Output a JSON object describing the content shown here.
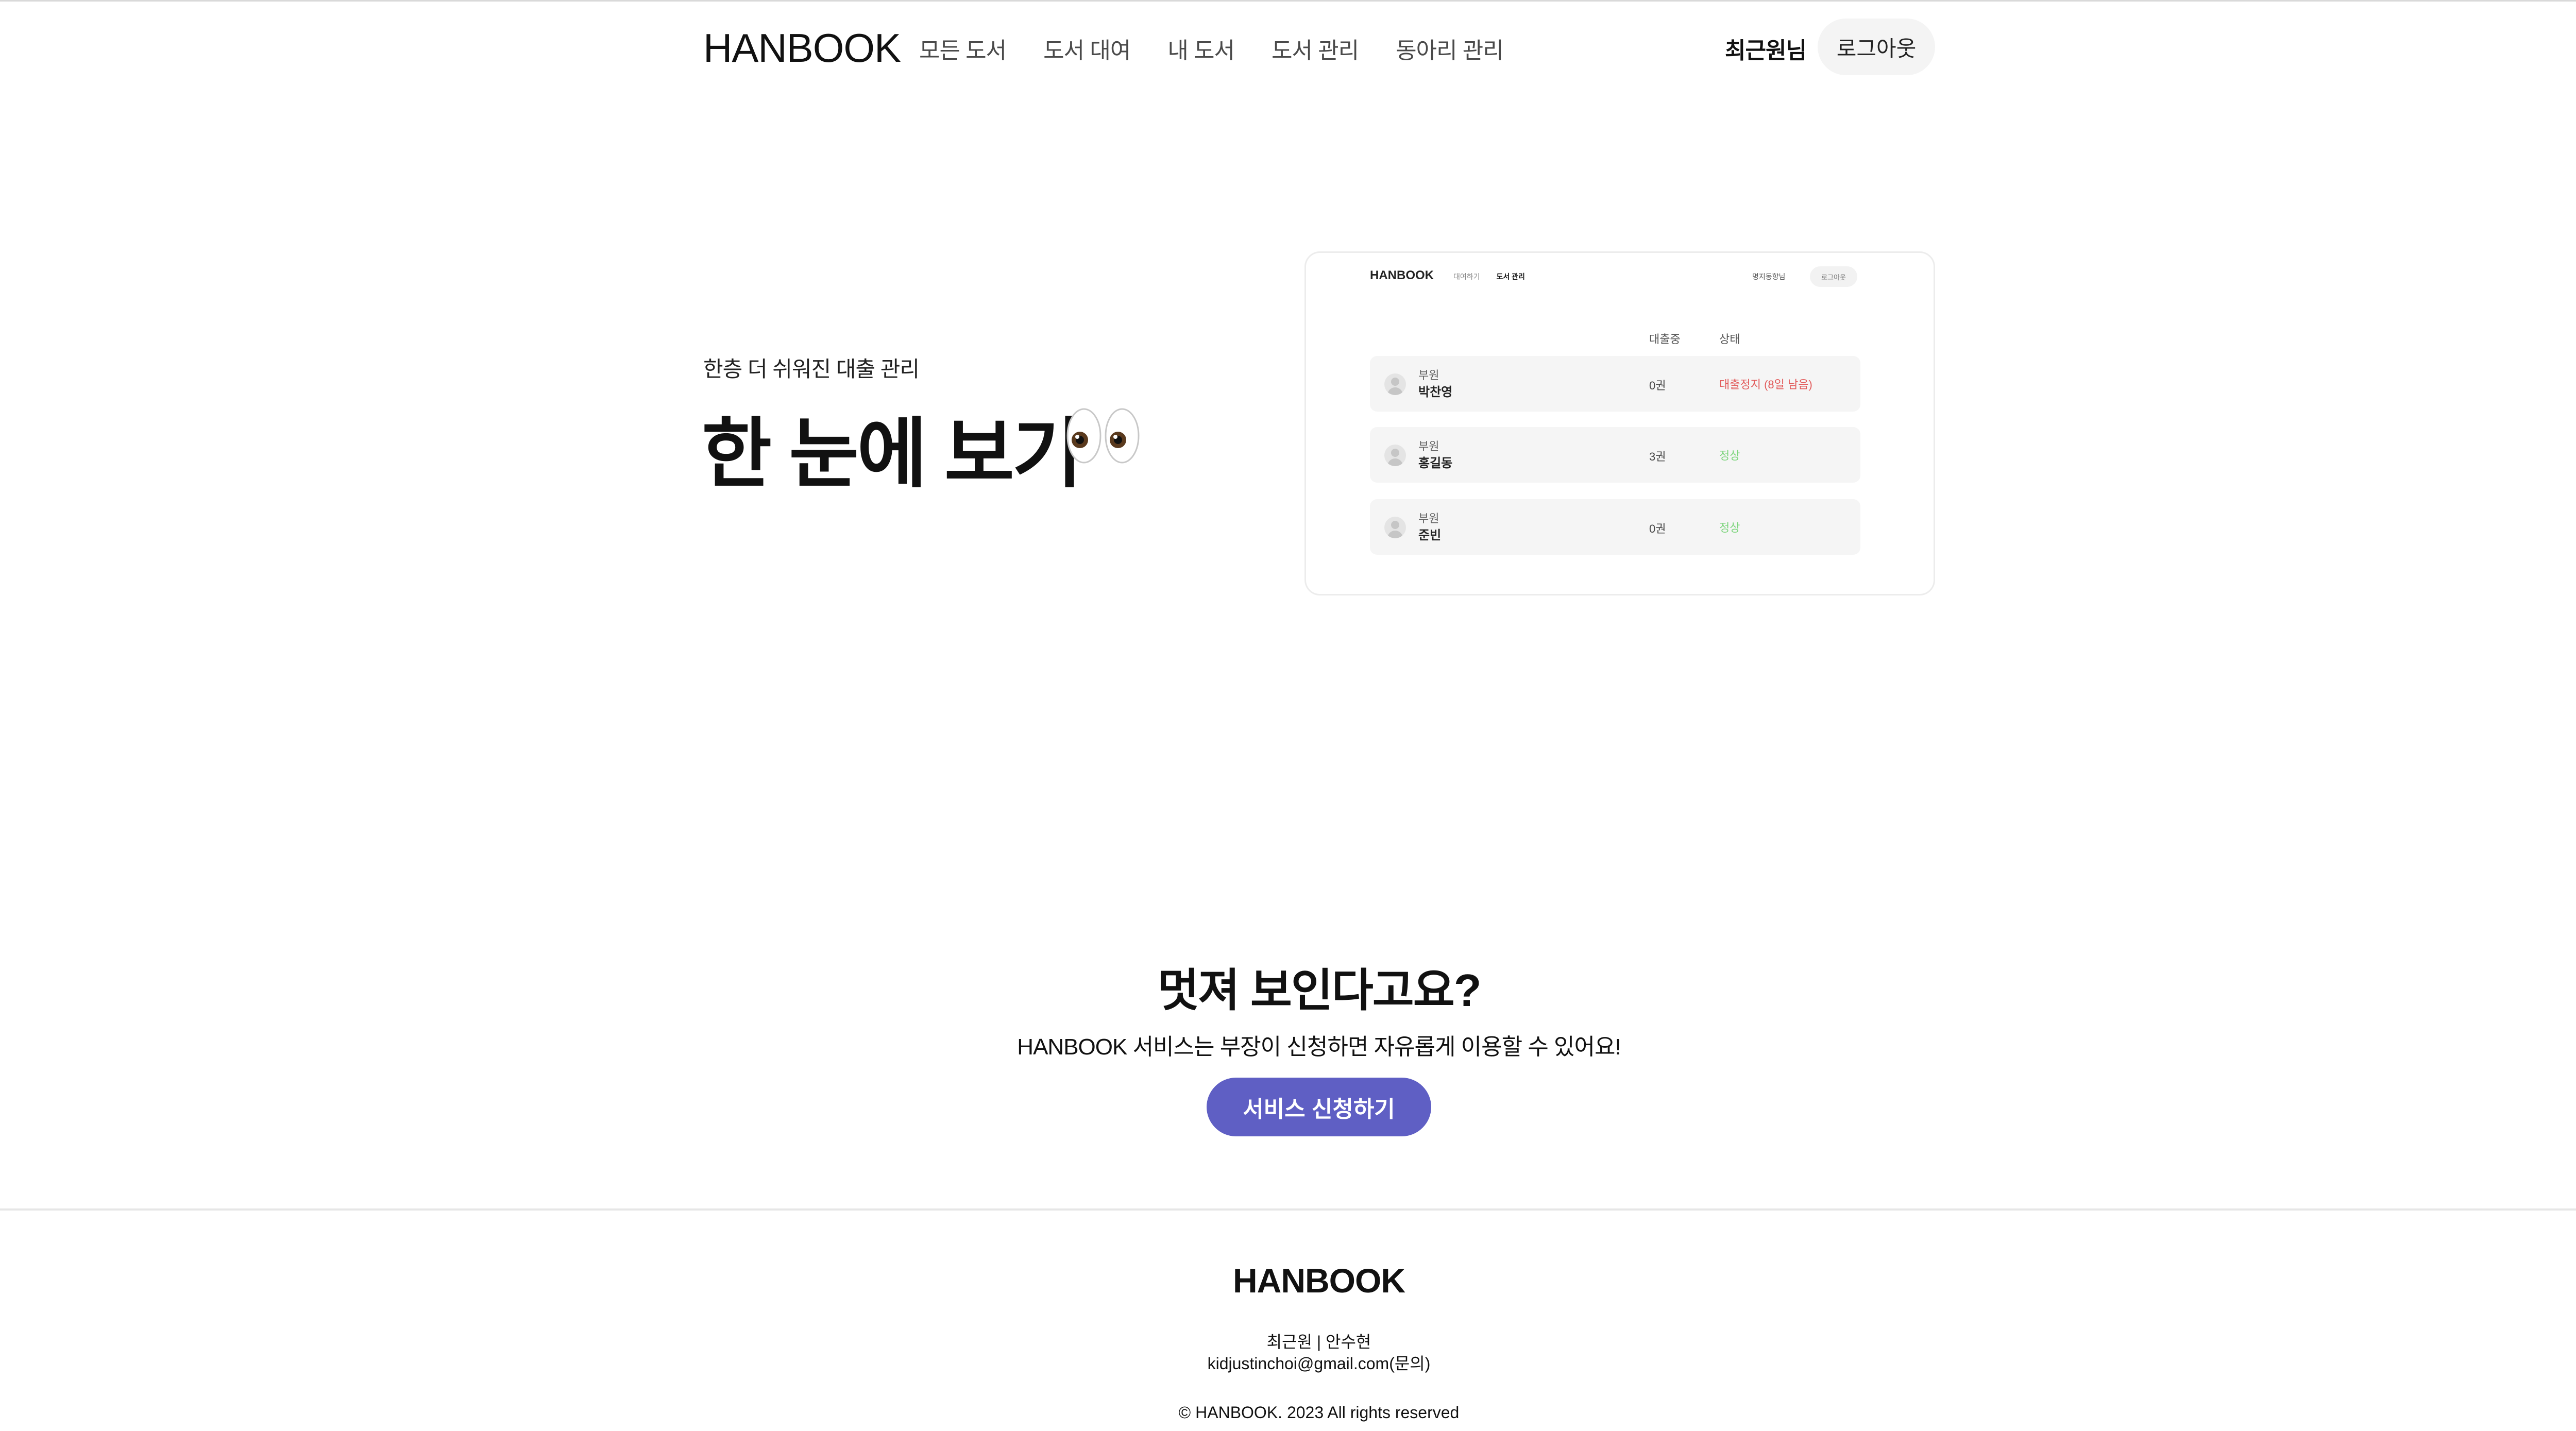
{
  "header": {
    "logo": "HANBOOK",
    "nav": [
      "모든 도서",
      "도서 대여",
      "내 도서",
      "도서 관리",
      "동아리 관리"
    ],
    "username": "최근원님",
    "logout_label": "로그아웃"
  },
  "hero": {
    "subtitle": "한층 더 쉬워진 대출 관리",
    "title": "한 눈에 보기",
    "emoji_icon": "eyes-icon"
  },
  "preview": {
    "logo": "HANBOOK",
    "nav": [
      "대여하기",
      "도서 관리"
    ],
    "active_nav": "도서 관리",
    "user": "명지동향님",
    "logout_label": "로그아웃",
    "columns": [
      "대출중",
      "상태"
    ],
    "rows": [
      {
        "role": "부원",
        "name": "박찬영",
        "count": "0권",
        "status": "대출정지 (8일 남음)",
        "status_color": "#e25b5b"
      },
      {
        "role": "부원",
        "name": "홍길동",
        "count": "3권",
        "status": "정상",
        "status_color": "#7bd47b"
      },
      {
        "role": "부원",
        "name": "준빈",
        "count": "0권",
        "status": "정상",
        "status_color": "#7bd47b"
      }
    ]
  },
  "cta": {
    "title": "멋져 보인다고요?",
    "description": "HANBOOK 서비스는 부장이 신청하면 자유롭게 이용할 수 있어요!",
    "button_label": "서비스 신청하기",
    "button_color": "#5f5fc4"
  },
  "footer": {
    "logo": "HANBOOK",
    "names": "최근원 | 안수현",
    "email": "kidjustinchoi@gmail.com(문의)",
    "copyright": "© HANBOOK. 2023 All rights reserved"
  }
}
